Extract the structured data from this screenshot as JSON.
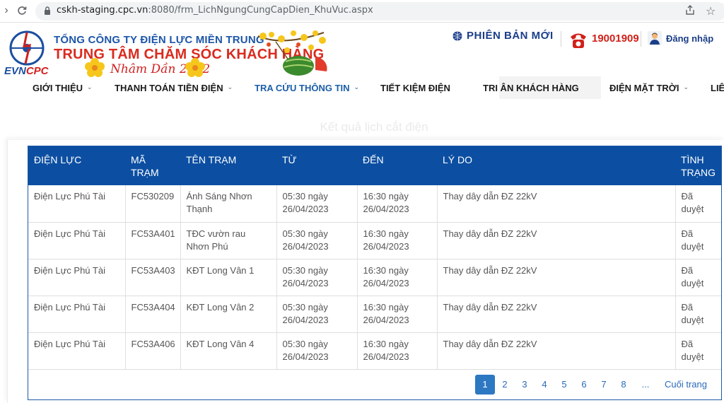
{
  "browser": {
    "url_host": "cskh-staging.cpc.vn",
    "url_path": ":8080/frm_LichNgungCungCapDien_KhuVuc.aspx"
  },
  "header": {
    "logo_text_evn": "EVN",
    "logo_text_cpc": "CPC",
    "corp_name": "TỔNG CÔNG TY ĐIỆN LỰC MIỀN TRUNG",
    "center_name": "TRUNG TÂM CHĂM SÓC KHÁCH HÀNG",
    "tet_text": "Nhâm Dần 2022",
    "version_label": "PHIÊN BẢN MỚI",
    "hotline": "19001909",
    "login_label": "Đăng nhập"
  },
  "nav": {
    "items": [
      {
        "label": "GIỚI THIỆU",
        "caret": true
      },
      {
        "label": "THANH TOÁN TIỀN ĐIỆN",
        "caret": true
      },
      {
        "label": "TRA CỨU THÔNG TIN",
        "caret": true
      },
      {
        "label": "TIẾT KIỆM ĐIỆN",
        "caret": false
      },
      {
        "label": "TRI ÂN KHÁCH HÀNG",
        "caret": false
      },
      {
        "label": "ĐIỆN MẶT TRỜI",
        "caret": true
      },
      {
        "label": "LIÊ",
        "caret": false
      }
    ]
  },
  "result_title": "Kết quả lịch cắt điện",
  "table": {
    "columns": [
      "ĐIỆN LỰC",
      "MÃ TRẠM",
      "TÊN TRẠM",
      "TỪ",
      "ĐẾN",
      "LÝ DO",
      "TÌNH TRẠNG"
    ],
    "rows": [
      [
        "Điện Lực Phú Tài",
        "FC530209",
        "Ánh Sáng Nhơn Thạnh",
        "05:30 ngày 26/04/2023",
        "16:30 ngày 26/04/2023",
        "Thay dây dẫn ĐZ 22kV",
        "Đã duyệt"
      ],
      [
        "Điện Lực Phú Tài",
        "FC53A401",
        "TĐC vườn rau Nhơn Phú",
        "05:30 ngày 26/04/2023",
        "16:30 ngày 26/04/2023",
        "Thay dây dẫn ĐZ 22kV",
        "Đã duyệt"
      ],
      [
        "Điện Lực Phú Tài",
        "FC53A403",
        "KĐT Long Vân 1",
        "05:30 ngày 26/04/2023",
        "16:30 ngày 26/04/2023",
        "Thay dây dẫn ĐZ 22kV",
        "Đã duyệt"
      ],
      [
        "Điện Lực Phú Tài",
        "FC53A404",
        "KĐT Long Vân 2",
        "05:30 ngày 26/04/2023",
        "16:30 ngày 26/04/2023",
        "Thay dây dẫn ĐZ 22kV",
        "Đã duyệt"
      ],
      [
        "Điện Lực Phú Tài",
        "FC53A406",
        "KĐT Long Vân 4",
        "05:30 ngày 26/04/2023",
        "16:30 ngày 26/04/2023",
        "Thay dây dẫn ĐZ 22kV",
        "Đã duyệt"
      ]
    ]
  },
  "pagination": {
    "pages": [
      "1",
      "2",
      "3",
      "4",
      "5",
      "6",
      "7",
      "8",
      "..."
    ],
    "current": "1",
    "last_label": "Cuối trang"
  },
  "colors": {
    "table_header": "#0c4fa2",
    "accent_red": "#d0211a",
    "brand_blue": "#1d56a9"
  }
}
